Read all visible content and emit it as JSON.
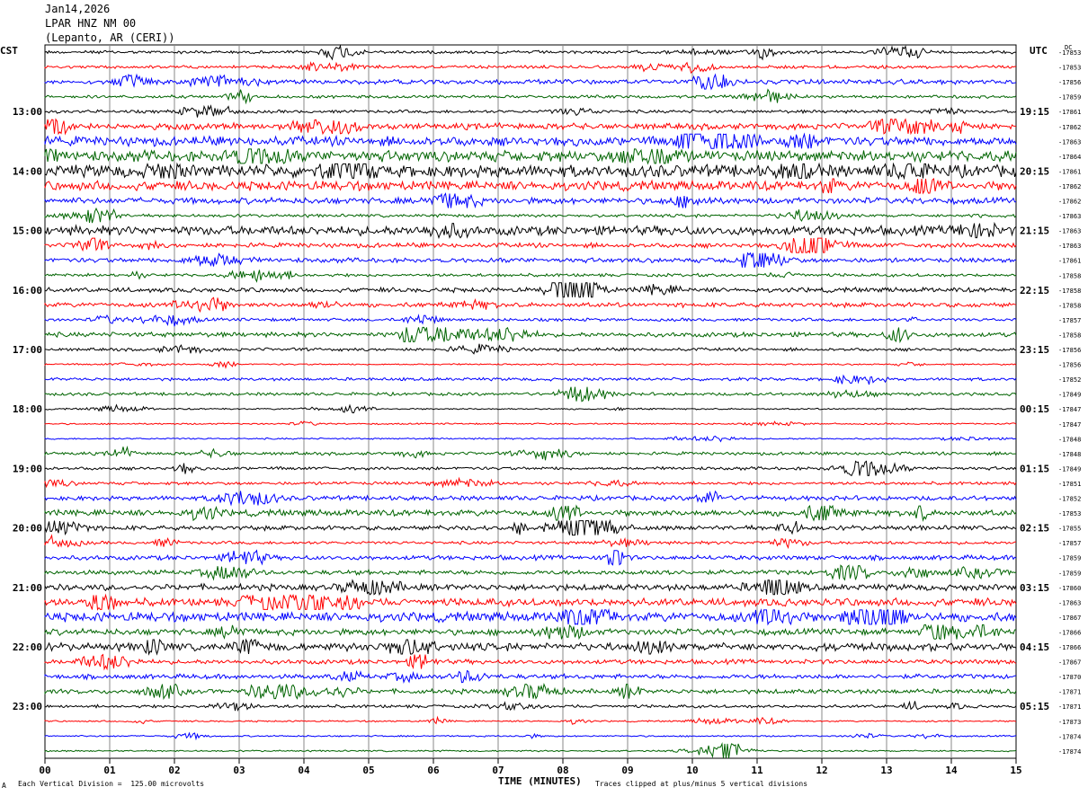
{
  "header": {
    "date": "Jan14,2026",
    "station": "LPAR HNZ NM 00",
    "location": "(Lepanto, AR (CERI))"
  },
  "left_tz": "CST",
  "right_tz": "UTC",
  "units_label": "DC",
  "footer": {
    "scale": "Each Vertical Division =  125.00 microvolts",
    "clip": "Traces clipped at plus/minus 5 vertical divisions",
    "corner_mark": "A"
  },
  "chart_data": {
    "type": "line",
    "title": "",
    "xlabel": "TIME (MINUTES)",
    "ylabel": "",
    "xlim": [
      0,
      15
    ],
    "x_ticks": [
      "00",
      "01",
      "02",
      "03",
      "04",
      "05",
      "06",
      "07",
      "08",
      "09",
      "10",
      "11",
      "12",
      "13",
      "14",
      "15"
    ],
    "trace_colors": [
      "#000000",
      "#ff0000",
      "#0000ff",
      "#006400"
    ],
    "minutes_per_trace": 15,
    "left_hour_labels": [
      "13:00",
      "14:00",
      "15:00",
      "16:00",
      "17:00",
      "18:00",
      "19:00",
      "20:00",
      "21:00",
      "22:00",
      "23:00"
    ],
    "right_hour_labels": [
      "19:15",
      "20:15",
      "21:15",
      "22:15",
      "23:15",
      "00:15",
      "01:15",
      "02:15",
      "03:15",
      "04:15",
      "05:15"
    ],
    "dc_offsets": [
      -17853,
      -17853,
      -17856,
      -17859,
      -17861,
      -17862,
      -17863,
      -17864,
      -17861,
      -17862,
      -17862,
      -17863,
      -17863,
      -17863,
      -17861,
      -17858,
      -17858,
      -17858,
      -17857,
      -17858,
      -17856,
      -17856,
      -17852,
      -17849,
      -17847,
      -17847,
      -17848,
      -17848,
      -17849,
      -17851,
      -17852,
      -17853,
      -17855,
      -17857,
      -17859,
      -17859,
      -17860,
      -17863,
      -17867,
      -17866,
      -17866,
      -17867,
      -17870,
      -17871,
      -17871,
      -17873,
      -17874,
      -17874
    ],
    "trace_amplitude": [
      2,
      2,
      3,
      2,
      2,
      4,
      6,
      7,
      8,
      6,
      4,
      2,
      6,
      3,
      3,
      2,
      3,
      3,
      2,
      3,
      2,
      1,
      2,
      2,
      1,
      1,
      1,
      2,
      2,
      2,
      3,
      4,
      3,
      2,
      3,
      3,
      4,
      5,
      6,
      4,
      5,
      3,
      3,
      3,
      2,
      1,
      1,
      1
    ]
  }
}
